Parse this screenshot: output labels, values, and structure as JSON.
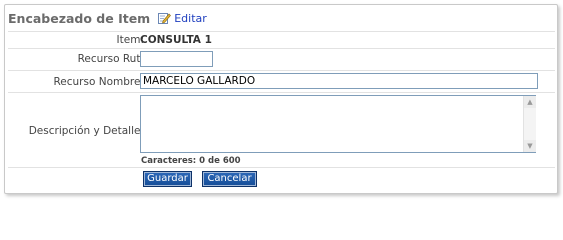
{
  "header": {
    "title": "Encabezado de Item",
    "edit_label": "Editar"
  },
  "form": {
    "item_label": "Item:",
    "item_value": "CONSULTA 1",
    "rut_label": "Recurso Rut:",
    "rut_value": "",
    "name_label": "Recurso Nombre:",
    "name_value": "MARCELO GALLARDO",
    "description_label": "Descripción y Detalle:",
    "description_value": "",
    "char_counter": "Caracteres: 0 de 600"
  },
  "buttons": {
    "save_label": "Guardar",
    "cancel_label": "Cancelar"
  },
  "colors": {
    "button_bg": "#1f5aa8",
    "link": "#1f3fbf",
    "title": "#6b6b6b"
  },
  "icons": {
    "edit": "pencil-note-icon"
  }
}
